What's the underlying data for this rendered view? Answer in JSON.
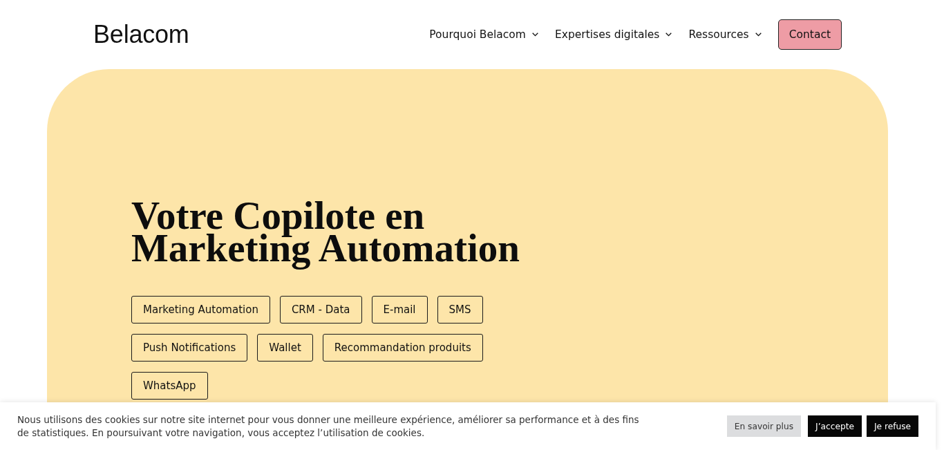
{
  "header": {
    "logo": "Belacom",
    "nav": [
      {
        "label": "Pourquoi Belacom",
        "dropdown": true
      },
      {
        "label": "Expertises digitales",
        "dropdown": true
      },
      {
        "label": "Ressources",
        "dropdown": true
      }
    ],
    "contact_button": "Contact"
  },
  "hero": {
    "title": "Votre Copilote en Marketing Automation",
    "tags": [
      "Marketing Automation",
      "CRM - Data",
      "E-mail",
      "SMS",
      "Push Notifications",
      "Wallet",
      "Recommandation produits",
      "WhatsApp"
    ]
  },
  "cookie_banner": {
    "text": "Nous utilisons des cookies sur notre site internet pour vous donner une meilleure expérience, améliorer sa performance et à des fins de statistiques. En poursuivant votre navigation, vous acceptez l’utilisation de cookies.",
    "buttons": [
      {
        "label": "En savoir plus",
        "kind": "secondary"
      },
      {
        "label": "J’accepte",
        "kind": "primary"
      },
      {
        "label": "Je refuse",
        "kind": "primary"
      }
    ]
  }
}
